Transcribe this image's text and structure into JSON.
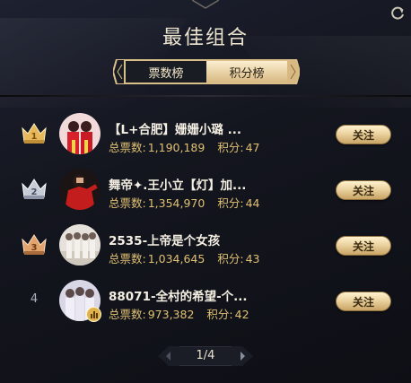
{
  "title": "最佳组合",
  "tabs": [
    {
      "label": "票数榜",
      "active": true
    },
    {
      "label": "积分榜",
      "active": false
    }
  ],
  "rows": [
    {
      "rank": "1",
      "name": "【L+合肥】姗姗小璐 ...",
      "votes_label": "总票数:",
      "votes": "1,190,189",
      "score_label": "积分:",
      "score": "47",
      "button": "关注",
      "badge": "gold-crown"
    },
    {
      "rank": "2",
      "name": "舞帝✦.王小立【灯】加...",
      "votes_label": "总票数:",
      "votes": "1,354,970",
      "score_label": "积分:",
      "score": "44",
      "button": "关注",
      "badge": "silver-crown"
    },
    {
      "rank": "3",
      "name": "2535-上帝是个女孩",
      "votes_label": "总票数:",
      "votes": "1,034,645",
      "score_label": "积分:",
      "score": "43",
      "button": "关注",
      "badge": "bronze-crown"
    },
    {
      "rank": "4",
      "name": "88071-全村的希望-个...",
      "votes_label": "总票数:",
      "votes": "973,382",
      "score_label": "积分:",
      "score": "42",
      "button": "关注",
      "badge": ""
    }
  ],
  "pager": {
    "label": "1/4"
  },
  "colors": {
    "accent_gold": "#e0c072",
    "button_gold": "#ebd3a0",
    "background": "#14161f"
  }
}
